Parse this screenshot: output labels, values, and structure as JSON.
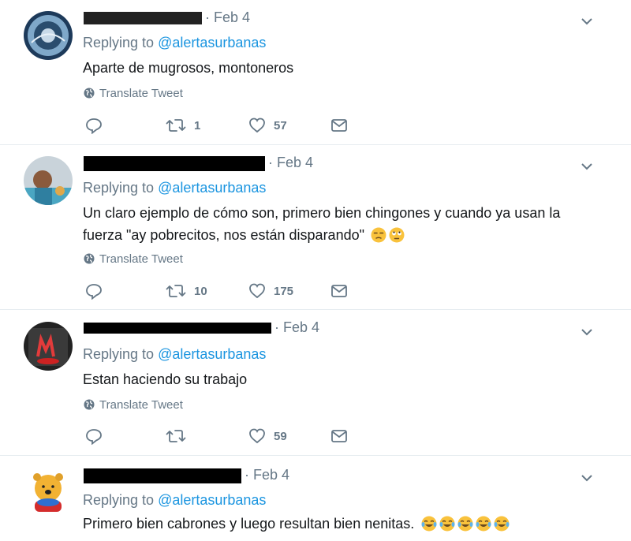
{
  "tweets": [
    {
      "date": "· Feb 4",
      "replying_prefix": "Replying to ",
      "replying_handle": "@alertasurbanas",
      "text": "Aparte de mugrosos, montoneros",
      "translate_label": "Translate Tweet",
      "retweets": "1",
      "likes": "57"
    },
    {
      "date": "· Feb 4",
      "replying_prefix": "Replying to ",
      "replying_handle": "@alertasurbanas",
      "text_line1": "Un claro ejemplo de cómo son, primero bien chingones y cuando ya usan la",
      "text_line2": "fuerza \"ay pobrecitos, nos están disparando\"",
      "emojis": [
        "unamused-face",
        "face-with-rolling-eyes"
      ],
      "translate_label": "Translate Tweet",
      "retweets": "10",
      "likes": "175"
    },
    {
      "date": "· Feb 4",
      "replying_prefix": "Replying to ",
      "replying_handle": "@alertasurbanas",
      "text": "Estan haciendo su trabajo",
      "translate_label": "Translate Tweet",
      "retweets": "",
      "likes": "59"
    },
    {
      "date": "· Feb 4",
      "replying_prefix": "Replying to ",
      "replying_handle": "@alertasurbanas",
      "text": "Primero bien cabrones y luego resultan bien nenitas.",
      "emojis": [
        "tears-of-joy",
        "tears-of-joy",
        "tears-of-joy",
        "tears-of-joy",
        "tears-of-joy"
      ]
    }
  ],
  "colors": {
    "link": "#1b95e0",
    "muted": "#657786",
    "text": "#14171a",
    "divider": "#e6ecf0"
  }
}
